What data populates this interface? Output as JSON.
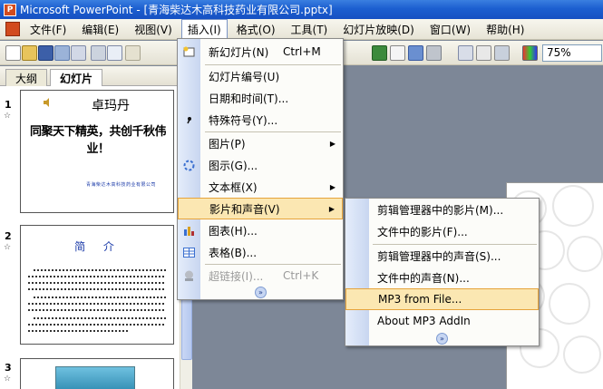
{
  "window": {
    "title": "Microsoft PowerPoint - [青海柴达木高科技药业有限公司.pptx]"
  },
  "menubar": {
    "items": [
      "文件(F)",
      "编辑(E)",
      "视图(V)",
      "插入(I)",
      "格式(O)",
      "工具(T)",
      "幻灯片放映(D)",
      "窗口(W)",
      "帮助(H)"
    ],
    "active": "插入(I)"
  },
  "toolbar": {
    "zoom": "75%"
  },
  "left_panel": {
    "tabs": [
      "大纲",
      "幻灯片"
    ],
    "active_tab": "幻灯片",
    "close": "×",
    "slides": [
      {
        "number": "1",
        "title": "卓玛丹",
        "subtitle": "同聚天下精英，共创千秋伟业！",
        "footer": "青海柴达木高科技药业有限公司"
      },
      {
        "number": "2",
        "title": "简 介"
      },
      {
        "number": "3"
      }
    ],
    "star": "☆"
  },
  "insert_menu": {
    "items": [
      {
        "label": "新幻灯片(N)",
        "shortcut": "Ctrl+M",
        "icon": "new-slide-icon"
      },
      {
        "label": "幻灯片编号(U)"
      },
      {
        "label": "日期和时间(T)..."
      },
      {
        "label": "特殊符号(Y)...",
        "icon": "symbol-icon"
      },
      {
        "label": "图片(P)",
        "submenu": true
      },
      {
        "label": "图示(G)...",
        "icon": "diagram-icon"
      },
      {
        "label": "文本框(X)",
        "submenu": true
      },
      {
        "label": "影片和声音(V)",
        "submenu": true,
        "highlighted": true
      },
      {
        "label": "图表(H)...",
        "icon": "chart-icon"
      },
      {
        "label": "表格(B)...",
        "icon": "table-icon"
      },
      {
        "label": "超链接(I)...",
        "shortcut": "Ctrl+K",
        "disabled": true,
        "icon": "hyperlink-icon"
      }
    ]
  },
  "movie_sound_menu": {
    "items": [
      {
        "label": "剪辑管理器中的影片(M)..."
      },
      {
        "label": "文件中的影片(F)..."
      },
      {
        "label": "剪辑管理器中的声音(S)..."
      },
      {
        "label": "文件中的声音(N)..."
      },
      {
        "label": "MP3 from File...",
        "highlighted": true
      },
      {
        "label": "About MP3 AddIn"
      }
    ]
  },
  "colors": {
    "titlebar": "#1c5fd0",
    "highlight": "#fbe7b2",
    "menu_gutter": "#c8d6f0"
  }
}
